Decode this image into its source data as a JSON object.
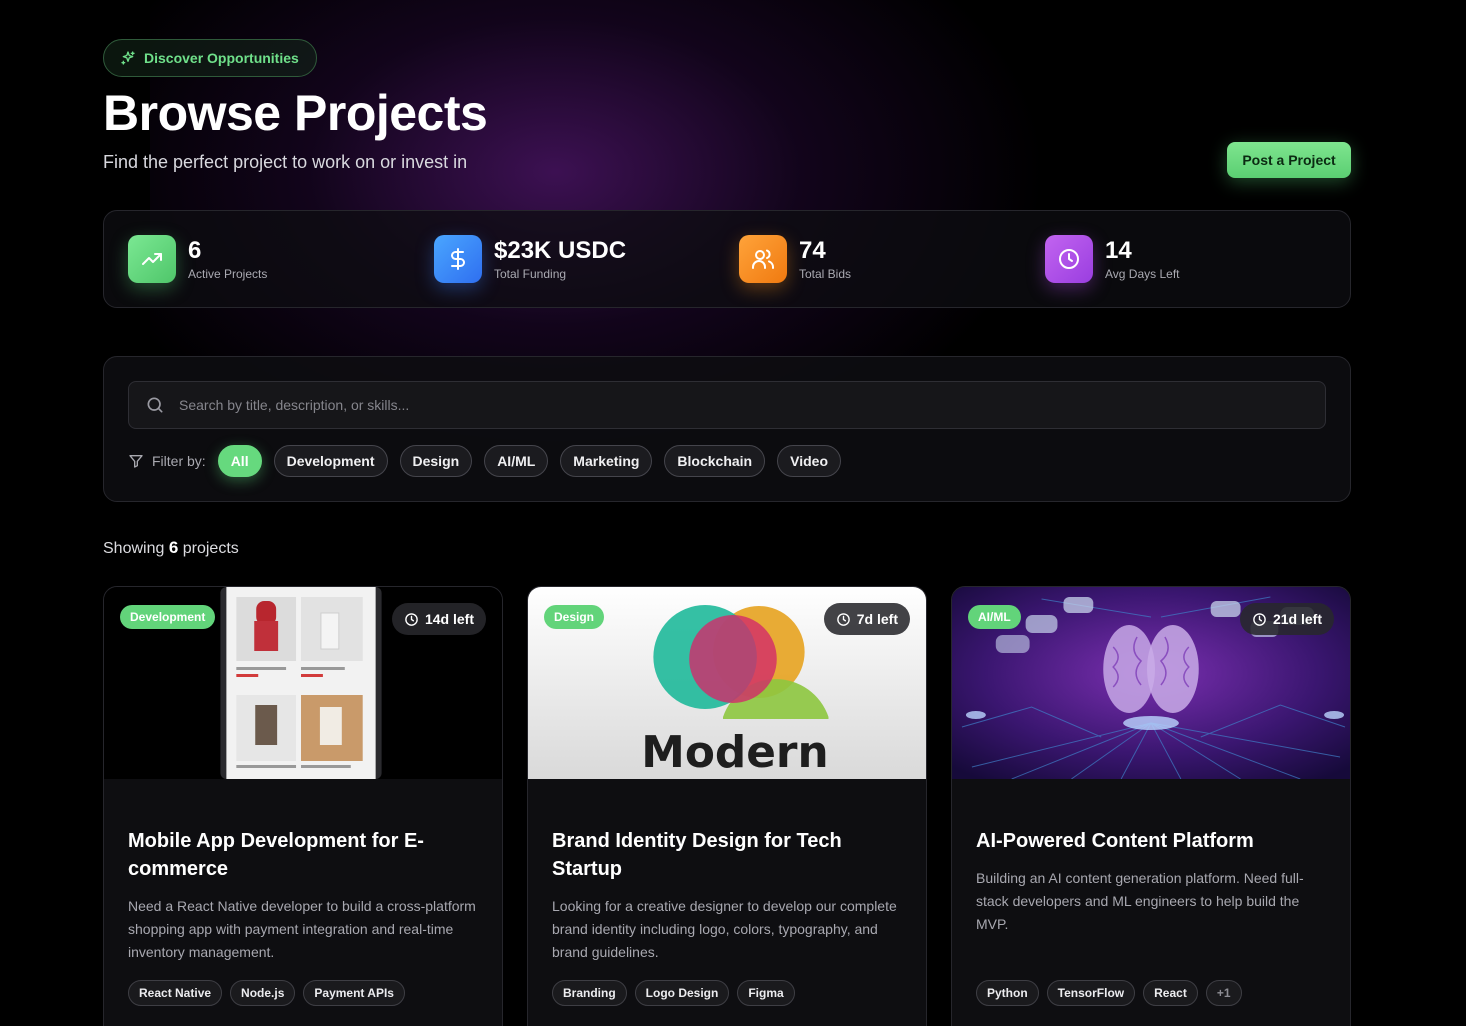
{
  "header": {
    "badge_label": "Discover Opportunities",
    "title": "Browse Projects",
    "subtitle": "Find the perfect project to work on or invest in",
    "post_button": "Post a Project"
  },
  "stats": [
    {
      "value": "6",
      "label": "Active Projects",
      "icon": "trending-up-icon",
      "color": "#5fd37a"
    },
    {
      "value": "$23K USDC",
      "label": "Total Funding",
      "icon": "dollar-icon",
      "color": "#3b8ef5"
    },
    {
      "value": "74",
      "label": "Total Bids",
      "icon": "users-icon",
      "color": "#f5921e"
    },
    {
      "value": "14",
      "label": "Avg Days Left",
      "icon": "clock-icon",
      "color": "#b04ee6"
    }
  ],
  "search": {
    "placeholder": "Search by title, description, or skills..."
  },
  "filters": {
    "label": "Filter by:",
    "options": [
      "All",
      "Development",
      "Design",
      "AI/ML",
      "Marketing",
      "Blockchain",
      "Video"
    ],
    "active": "All"
  },
  "results": {
    "prefix": "Showing",
    "count": "6",
    "suffix": "projects"
  },
  "projects": [
    {
      "category": "Development",
      "time_left": "14d left",
      "title": "Mobile App Development for E-commerce",
      "description": "Need a React Native developer to build a cross-platform shopping app with payment integration and real-time inventory management.",
      "tags": [
        "React Native",
        "Node.js",
        "Payment APIs"
      ]
    },
    {
      "category": "Design",
      "time_left": "7d left",
      "title": "Brand Identity Design for Tech Startup",
      "description": "Looking for a creative designer to develop our complete brand identity including logo, colors, typography, and brand guidelines.",
      "tags": [
        "Branding",
        "Logo Design",
        "Figma"
      ],
      "image_text": "Modern"
    },
    {
      "category": "AI/ML",
      "time_left": "21d left",
      "title": "AI-Powered Content Platform",
      "description": "Building an AI content generation platform. Need full-stack developers and ML engineers to help build the MVP.",
      "tags": [
        "Python",
        "TensorFlow",
        "React",
        "+1"
      ]
    }
  ]
}
